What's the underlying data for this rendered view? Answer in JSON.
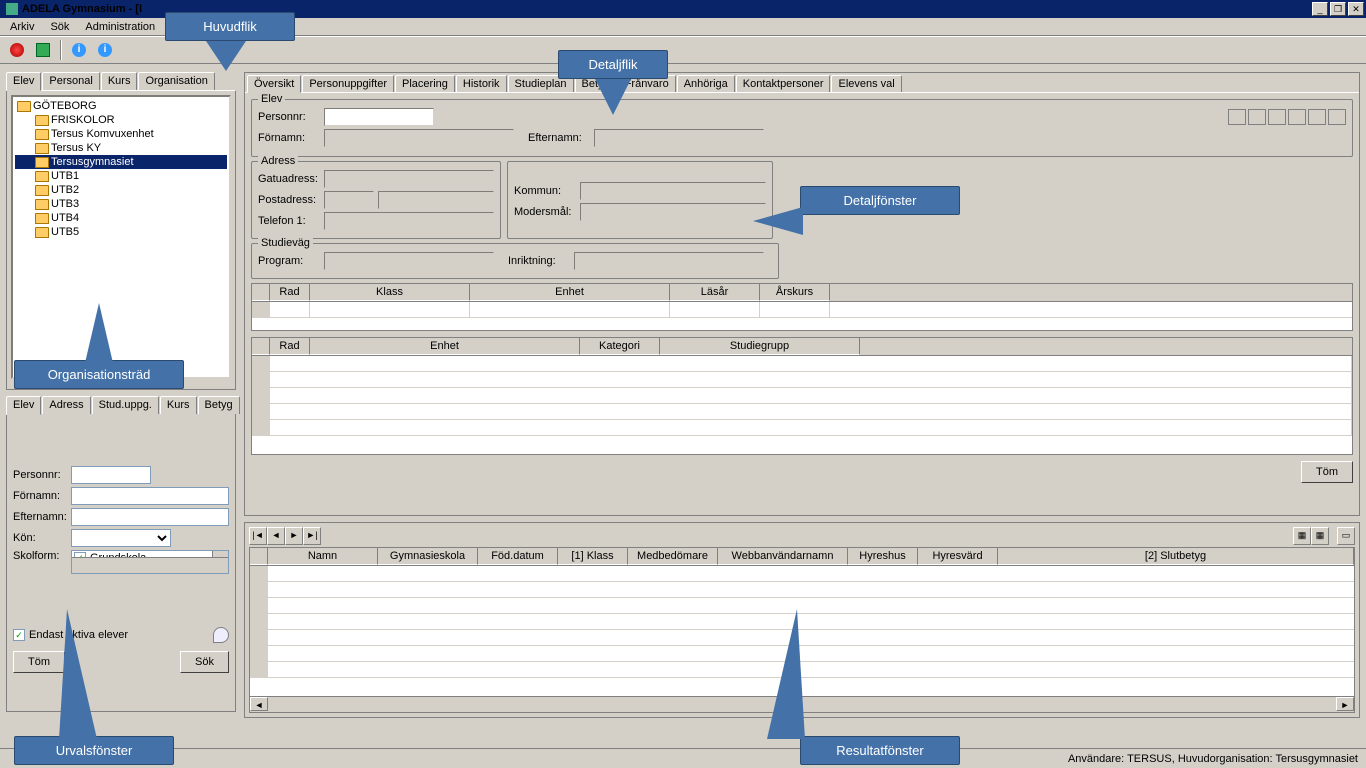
{
  "title": "ADELA Gymnasium - [I",
  "menu": {
    "arkiv": "Arkiv",
    "sok": "Sök",
    "admin": "Administration"
  },
  "main_tabs": {
    "elev": "Elev",
    "personal": "Personal",
    "kurs": "Kurs",
    "org": "Organisation"
  },
  "tree": {
    "root": "GÖTEBORG",
    "items": [
      "FRISKOLOR",
      "Tersus Komvuxenhet",
      "Tersus KY",
      "Tersusgymnasiet",
      "UTB1",
      "UTB2",
      "UTB3",
      "UTB4",
      "UTB5"
    ],
    "selected": "Tersusgymnasiet"
  },
  "filter_tabs": {
    "elev": "Elev",
    "adress": "Adress",
    "stud": "Stud.uppg.",
    "kurs": "Kurs",
    "betyg": "Betyg"
  },
  "filter": {
    "personnr": "Personnr:",
    "fornamn": "Förnamn:",
    "efternamn": "Efternamn:",
    "kon": "Kön:",
    "skolform": "Skolform:",
    "grundskola": "Grundskola",
    "endast": "Endast aktiva elever",
    "tom": "Töm",
    "sok": "Sök"
  },
  "detail_tabs": [
    "Översikt",
    "Personuppgifter",
    "Placering",
    "Historik",
    "Studieplan",
    "Betyg",
    "Frånvaro",
    "Anhöriga",
    "Kontaktpersoner",
    "Elevens val"
  ],
  "groups": {
    "elev": {
      "title": "Elev",
      "personnr": "Personnr:",
      "fornamn": "Förnamn:",
      "efternamn": "Efternamn:"
    },
    "adress": {
      "title": "Adress",
      "gatu": "Gatuadress:",
      "post": "Postadress:",
      "tel": "Telefon 1:"
    },
    "extra": {
      "kommun": "Kommun:",
      "moders": "Modersmål:"
    },
    "studievag": {
      "title": "Studieväg",
      "program": "Program:",
      "inriktning": "Inriktning:"
    }
  },
  "grid1": {
    "cols": [
      "Rad",
      "Klass",
      "Enhet",
      "Läsår",
      "Årskurs"
    ]
  },
  "grid2": {
    "cols": [
      "Rad",
      "Enhet",
      "Kategori",
      "Studiegrupp"
    ]
  },
  "tom_btn": "Töm",
  "result_cols": [
    "Namn",
    "Gymnasieskola",
    "Föd.datum",
    "[1] Klass",
    "Medbedömare",
    "Webbanvändarnamn",
    "Hyreshus",
    "Hyresvärd",
    "[2] Slutbetyg"
  ],
  "status": "Användare: TERSUS, Huvudorganisation: Tersusgymnasiet",
  "callouts": {
    "huvud": "Huvudflik",
    "detalj": "Detaljflik",
    "org": "Organisationsträd",
    "dfonster": "Detaljfönster",
    "urval": "Urvalsfönster",
    "result": "Resultatfönster"
  }
}
